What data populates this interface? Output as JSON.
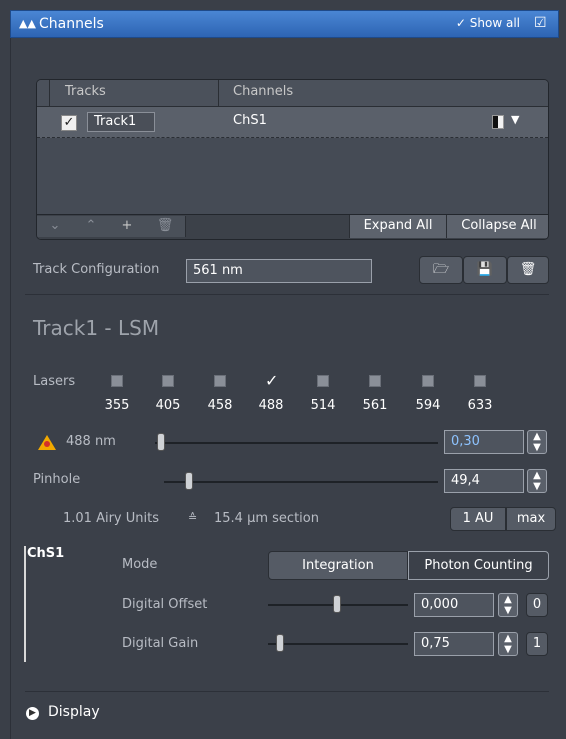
{
  "title": {
    "text": "Channels",
    "show_all": "✓ Show all"
  },
  "tracks_table": {
    "headers": {
      "tracks": "Tracks",
      "channels": "Channels"
    },
    "rows": [
      {
        "checked": true,
        "track": "Track1",
        "channel": "ChS1"
      }
    ],
    "footer": {
      "expand_all": "Expand All",
      "collapse_all": "Collapse All"
    }
  },
  "track_config": {
    "label": "Track Configuration",
    "value": "561 nm"
  },
  "track_heading": "Track1 - LSM",
  "lasers": {
    "label": "Lasers",
    "items": [
      {
        "wavelength": "355",
        "on": false
      },
      {
        "wavelength": "405",
        "on": false
      },
      {
        "wavelength": "458",
        "on": false
      },
      {
        "wavelength": "488",
        "on": true
      },
      {
        "wavelength": "514",
        "on": false
      },
      {
        "wavelength": "561",
        "on": false
      },
      {
        "wavelength": "594",
        "on": false
      },
      {
        "wavelength": "633",
        "on": false
      }
    ]
  },
  "laser_488": {
    "label": "488 nm",
    "value": "0,30"
  },
  "pinhole": {
    "label": "Pinhole",
    "value": "49,4",
    "airy": "1.01 Airy Units",
    "section": "15.4 µm section",
    "btn_1au": "1 AU",
    "btn_max": "max"
  },
  "channel": {
    "name": "ChS1",
    "mode_label": "Mode",
    "mode_integration": "Integration",
    "mode_photon": "Photon Counting",
    "offset_label": "Digital Offset",
    "offset_value": "0,000",
    "offset_reset": "0",
    "gain_label": "Digital Gain",
    "gain_value": "0,75",
    "gain_reset": "1"
  },
  "display_label": "Display",
  "colors": {
    "titlebar": "#3b74c4",
    "warning": "#f2a900",
    "accent_value": "#8ec3ff"
  }
}
